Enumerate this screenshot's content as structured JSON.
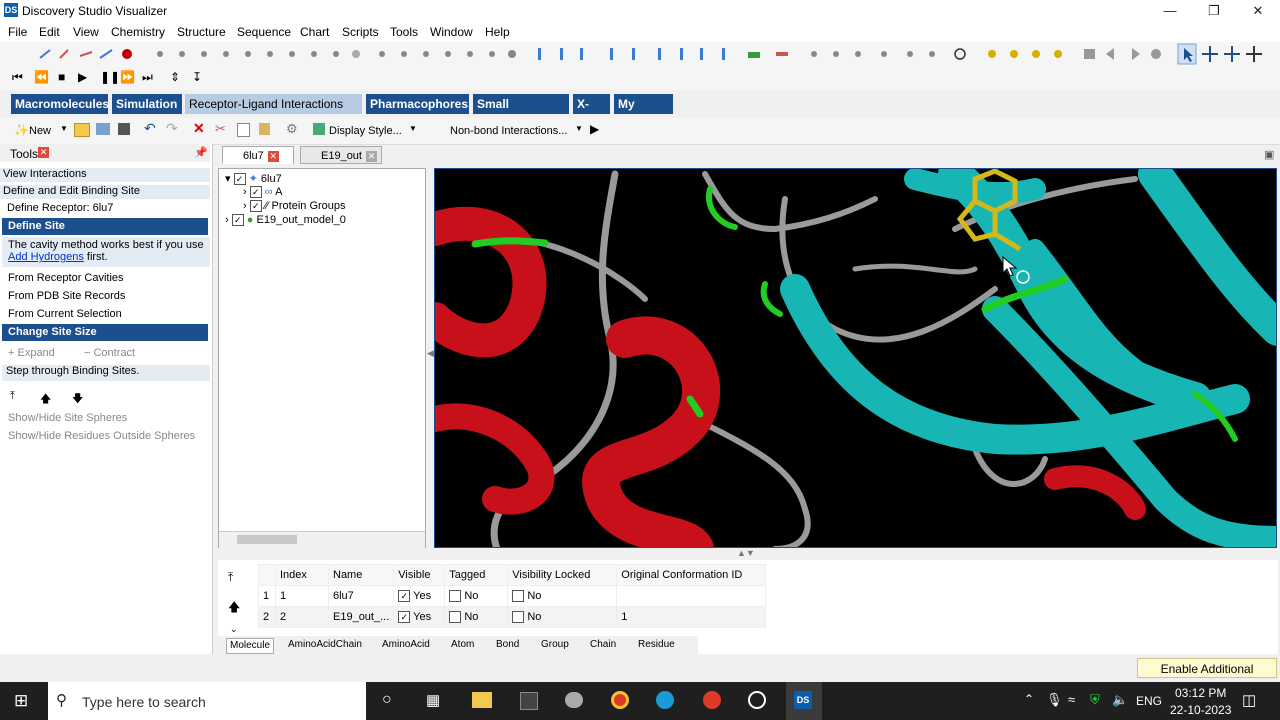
{
  "window": {
    "title": "Discovery Studio Visualizer"
  },
  "menu": [
    "File",
    "Edit",
    "View",
    "Chemistry",
    "Structure",
    "Sequence",
    "Chart",
    "Scripts",
    "Tools",
    "Window",
    "Help"
  ],
  "primary_tabs": [
    "Macromolecules",
    "Simulation",
    "Receptor-Ligand Interactions",
    "Pharmacophores",
    "Small Molecules",
    "X-ray",
    "My Tools"
  ],
  "primary_tabs_active": "Receptor-Ligand Interactions",
  "toolbar3": {
    "new_label": "New",
    "display_style": "Display Style...",
    "nonbond": "Non-bond Interactions..."
  },
  "tools_panel": {
    "title": "Tools",
    "view_interactions": "View Interactions",
    "define_edit": "Define and Edit Binding Site",
    "define_receptor": "Define Receptor: 6lu7",
    "define_site": "Define Site",
    "cavity_note_1": "The cavity method works best if you use",
    "cavity_link": "Add Hydrogens",
    "cavity_note_2": "first.",
    "from_cavities": "From Receptor Cavities",
    "from_pdb": "From PDB Site Records",
    "from_selection": "From Current Selection",
    "change_site": "Change Site Size",
    "expand": "Expand",
    "contract": "Contract",
    "step_through": "Step through Binding Sites.",
    "show_hide_spheres": "Show/Hide Site Spheres",
    "show_hide_residues": "Show/Hide Residues Outside Spheres"
  },
  "doc_tabs": [
    "6lu7",
    "E19_out"
  ],
  "tree": {
    "root": "6lu7",
    "chain": "A",
    "groups": "Protein Groups",
    "model": "E19_out_model_0"
  },
  "grid": {
    "headers": [
      "Index",
      "Name",
      "Visible",
      "Tagged",
      "Visibility Locked",
      "Original Conformation ID"
    ],
    "rows": [
      {
        "row": "1",
        "index": "1",
        "name": "6lu7",
        "visible": "Yes",
        "tagged": "No",
        "locked": "No",
        "conf": ""
      },
      {
        "row": "2",
        "index": "2",
        "name": "E19_out_...",
        "visible": "Yes",
        "tagged": "No",
        "locked": "No",
        "conf": "1"
      }
    ]
  },
  "bottom_tabs": [
    "Molecule",
    "AminoAcidChain",
    "AminoAcid",
    "Atom",
    "Bond",
    "Group",
    "Chain",
    "Residue"
  ],
  "enable_features": "Enable Additional Features",
  "taskbar": {
    "search_placeholder": "Type here to search",
    "lang": "ENG",
    "time": "03:12 PM",
    "date": "22-10-2023"
  }
}
